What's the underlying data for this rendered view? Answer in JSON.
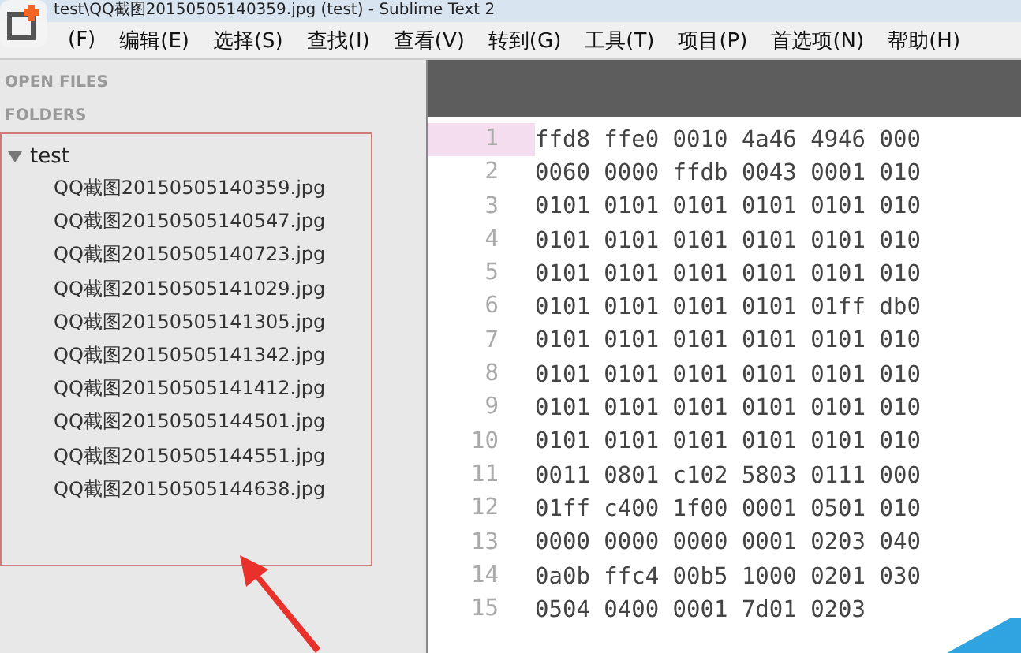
{
  "window": {
    "title": "test\\QQ截图20150505140359.jpg (test) - Sublime Text 2"
  },
  "menu": [
    "(F)",
    "编辑(E)",
    "选择(S)",
    "查找(I)",
    "查看(V)",
    "转到(G)",
    "工具(T)",
    "项目(P)",
    "首选项(N)",
    "帮助(H)"
  ],
  "sidebar": {
    "sections": [
      "OPEN FILES",
      "FOLDERS"
    ],
    "folder": {
      "name": "test",
      "expanded": true,
      "files": [
        "QQ截图20150505140359.jpg",
        "QQ截图20150505140547.jpg",
        "QQ截图20150505140723.jpg",
        "QQ截图20150505141029.jpg",
        "QQ截图20150505141305.jpg",
        "QQ截图20150505141342.jpg",
        "QQ截图20150505141412.jpg",
        "QQ截图20150505144501.jpg",
        "QQ截图20150505144551.jpg",
        "QQ截图20150505144638.jpg"
      ]
    }
  },
  "editor": {
    "lines": [
      {
        "number": "1",
        "text": "ffd8 ffe0 0010 4a46 4946 000",
        "current": true
      },
      {
        "number": "2",
        "text": "0060 0000 ffdb 0043 0001 010",
        "current": false
      },
      {
        "number": "3",
        "text": "0101 0101 0101 0101 0101 010",
        "current": false
      },
      {
        "number": "4",
        "text": "0101 0101 0101 0101 0101 010",
        "current": false
      },
      {
        "number": "5",
        "text": "0101 0101 0101 0101 0101 010",
        "current": false
      },
      {
        "number": "6",
        "text": "0101 0101 0101 0101 01ff db0",
        "current": false
      },
      {
        "number": "7",
        "text": "0101 0101 0101 0101 0101 010",
        "current": false
      },
      {
        "number": "8",
        "text": "0101 0101 0101 0101 0101 010",
        "current": false
      },
      {
        "number": "9",
        "text": "0101 0101 0101 0101 0101 010",
        "current": false
      },
      {
        "number": "10",
        "text": "0101 0101 0101 0101 0101 010",
        "current": false
      },
      {
        "number": "11",
        "text": "0011 0801 c102 5803 0111 000",
        "current": false
      },
      {
        "number": "12",
        "text": "01ff c400 1f00 0001 0501 010",
        "current": false
      },
      {
        "number": "13",
        "text": "0000 0000 0000 0001 0203 040",
        "current": false
      },
      {
        "number": "14",
        "text": "0a0b ffc4 00b5 1000 0201 030",
        "current": false
      },
      {
        "number": "15",
        "text": "0504 0400 0001 7d01 0203",
        "current": false
      }
    ]
  }
}
